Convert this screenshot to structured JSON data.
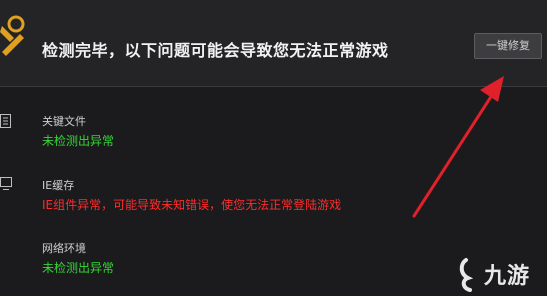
{
  "header": {
    "title": "检测完毕，以下问题可能会导致您无法正常游戏",
    "fix_button_label": "一键修复"
  },
  "items": [
    {
      "title": "关键文件",
      "status": "未检测出异常",
      "state": "ok"
    },
    {
      "title": "IE缓存",
      "status": "IE组件异常，可能导致未知错误，使您无法正常登陆游戏",
      "state": "error"
    },
    {
      "title": "网络环境",
      "status": "未检测出异常",
      "state": "ok"
    }
  ],
  "watermark": {
    "text": "九游"
  },
  "colors": {
    "ok": "#35d635",
    "error": "#ff2b2b",
    "accent": "#e0a020",
    "arrow": "#e0202a"
  },
  "icons": {
    "header": "tools-icon",
    "row1": "document-icon",
    "row2": "monitor-icon",
    "row3": "network-icon"
  }
}
